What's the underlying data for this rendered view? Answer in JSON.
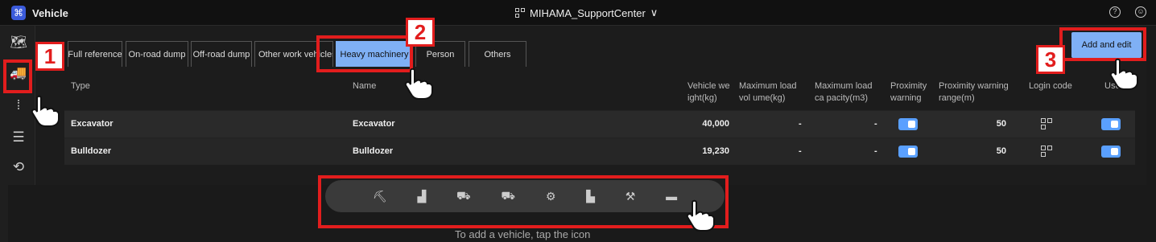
{
  "app": {
    "title": "Vehicle",
    "logo_glyph": "⌘"
  },
  "header": {
    "center_label": "MIHAMA_SupportCenter",
    "center_chevron": "∨",
    "help_glyph": "?",
    "account_glyph": "☺"
  },
  "sidebar": {
    "items": [
      {
        "name": "map-icon",
        "glyph": "🗺"
      },
      {
        "name": "vehicle-icon",
        "glyph": "🚚"
      },
      {
        "name": "route-edit-icon",
        "glyph": "⁞"
      },
      {
        "name": "list-icon",
        "glyph": "☰"
      },
      {
        "name": "history-icon",
        "glyph": "⟲"
      }
    ]
  },
  "tabs": [
    "Full reference",
    "On-road dump",
    "Off-road dump",
    "Other work vehicles",
    "Heavy machinery",
    "Person",
    "Others"
  ],
  "active_tab": "Heavy machinery",
  "add_button": "Add and edit",
  "table": {
    "headers": {
      "type": "Type",
      "name": "Name",
      "weight": "Vehicle we ight(kg)",
      "max_vol": "Maximum load vol ume(kg)",
      "max_cap": "Maximum load ca pacity(m3)",
      "prox": "Proximity warning",
      "prox_range": "Proximity warning range(m)",
      "login": "Login code",
      "use": "Use"
    },
    "rows": [
      {
        "type": "Excavator",
        "name": "Excavator",
        "weight": "40,000",
        "max_vol": "-",
        "max_cap": "-",
        "range": "50",
        "prox_on": true,
        "use_on": true
      },
      {
        "type": "Bulldozer",
        "name": "Bulldozer",
        "weight": "19,230",
        "max_vol": "-",
        "max_cap": "-",
        "range": "50",
        "prox_on": true,
        "use_on": true
      }
    ]
  },
  "vehicle_icons": [
    "excavator-icon",
    "bulldozer-icon",
    "wheel-loader-icon",
    "dump-truck-icon",
    "tractor-icon",
    "forklift-icon",
    "crane-icon",
    "paver-icon"
  ],
  "vehicle_glyphs": [
    "⛏",
    "▟",
    "⛟",
    "⛟",
    "⚙",
    "▙",
    "⚒",
    "▬"
  ],
  "hint": "To add a vehicle, tap the icon",
  "callouts": [
    "1",
    "2",
    "3"
  ],
  "colors": {
    "accent": "#7fb0f5",
    "toggle": "#5aa0ff",
    "callout": "#e21d1d"
  }
}
